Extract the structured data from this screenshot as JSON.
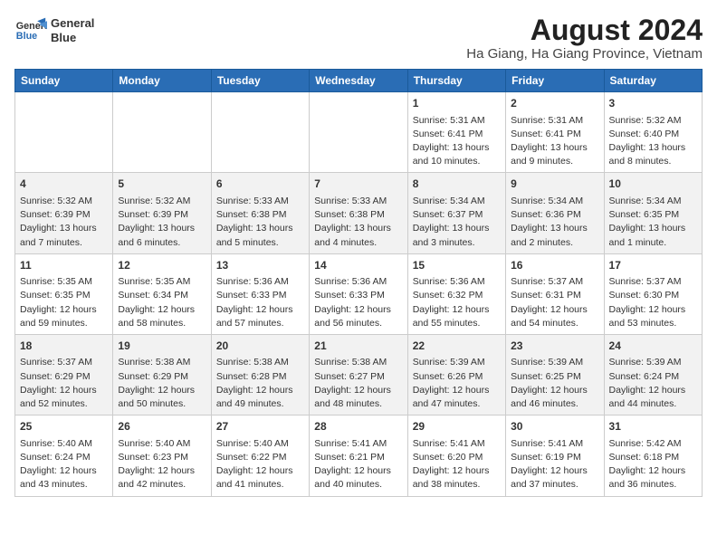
{
  "header": {
    "logo_line1": "General",
    "logo_line2": "Blue",
    "title": "August 2024",
    "subtitle": "Ha Giang, Ha Giang Province, Vietnam"
  },
  "days_of_week": [
    "Sunday",
    "Monday",
    "Tuesday",
    "Wednesday",
    "Thursday",
    "Friday",
    "Saturday"
  ],
  "weeks": [
    [
      {
        "day": "",
        "content": ""
      },
      {
        "day": "",
        "content": ""
      },
      {
        "day": "",
        "content": ""
      },
      {
        "day": "",
        "content": ""
      },
      {
        "day": "1",
        "content": "Sunrise: 5:31 AM\nSunset: 6:41 PM\nDaylight: 13 hours\nand 10 minutes."
      },
      {
        "day": "2",
        "content": "Sunrise: 5:31 AM\nSunset: 6:41 PM\nDaylight: 13 hours\nand 9 minutes."
      },
      {
        "day": "3",
        "content": "Sunrise: 5:32 AM\nSunset: 6:40 PM\nDaylight: 13 hours\nand 8 minutes."
      }
    ],
    [
      {
        "day": "4",
        "content": "Sunrise: 5:32 AM\nSunset: 6:39 PM\nDaylight: 13 hours\nand 7 minutes."
      },
      {
        "day": "5",
        "content": "Sunrise: 5:32 AM\nSunset: 6:39 PM\nDaylight: 13 hours\nand 6 minutes."
      },
      {
        "day": "6",
        "content": "Sunrise: 5:33 AM\nSunset: 6:38 PM\nDaylight: 13 hours\nand 5 minutes."
      },
      {
        "day": "7",
        "content": "Sunrise: 5:33 AM\nSunset: 6:38 PM\nDaylight: 13 hours\nand 4 minutes."
      },
      {
        "day": "8",
        "content": "Sunrise: 5:34 AM\nSunset: 6:37 PM\nDaylight: 13 hours\nand 3 minutes."
      },
      {
        "day": "9",
        "content": "Sunrise: 5:34 AM\nSunset: 6:36 PM\nDaylight: 13 hours\nand 2 minutes."
      },
      {
        "day": "10",
        "content": "Sunrise: 5:34 AM\nSunset: 6:35 PM\nDaylight: 13 hours\nand 1 minute."
      }
    ],
    [
      {
        "day": "11",
        "content": "Sunrise: 5:35 AM\nSunset: 6:35 PM\nDaylight: 12 hours\nand 59 minutes."
      },
      {
        "day": "12",
        "content": "Sunrise: 5:35 AM\nSunset: 6:34 PM\nDaylight: 12 hours\nand 58 minutes."
      },
      {
        "day": "13",
        "content": "Sunrise: 5:36 AM\nSunset: 6:33 PM\nDaylight: 12 hours\nand 57 minutes."
      },
      {
        "day": "14",
        "content": "Sunrise: 5:36 AM\nSunset: 6:33 PM\nDaylight: 12 hours\nand 56 minutes."
      },
      {
        "day": "15",
        "content": "Sunrise: 5:36 AM\nSunset: 6:32 PM\nDaylight: 12 hours\nand 55 minutes."
      },
      {
        "day": "16",
        "content": "Sunrise: 5:37 AM\nSunset: 6:31 PM\nDaylight: 12 hours\nand 54 minutes."
      },
      {
        "day": "17",
        "content": "Sunrise: 5:37 AM\nSunset: 6:30 PM\nDaylight: 12 hours\nand 53 minutes."
      }
    ],
    [
      {
        "day": "18",
        "content": "Sunrise: 5:37 AM\nSunset: 6:29 PM\nDaylight: 12 hours\nand 52 minutes."
      },
      {
        "day": "19",
        "content": "Sunrise: 5:38 AM\nSunset: 6:29 PM\nDaylight: 12 hours\nand 50 minutes."
      },
      {
        "day": "20",
        "content": "Sunrise: 5:38 AM\nSunset: 6:28 PM\nDaylight: 12 hours\nand 49 minutes."
      },
      {
        "day": "21",
        "content": "Sunrise: 5:38 AM\nSunset: 6:27 PM\nDaylight: 12 hours\nand 48 minutes."
      },
      {
        "day": "22",
        "content": "Sunrise: 5:39 AM\nSunset: 6:26 PM\nDaylight: 12 hours\nand 47 minutes."
      },
      {
        "day": "23",
        "content": "Sunrise: 5:39 AM\nSunset: 6:25 PM\nDaylight: 12 hours\nand 46 minutes."
      },
      {
        "day": "24",
        "content": "Sunrise: 5:39 AM\nSunset: 6:24 PM\nDaylight: 12 hours\nand 44 minutes."
      }
    ],
    [
      {
        "day": "25",
        "content": "Sunrise: 5:40 AM\nSunset: 6:24 PM\nDaylight: 12 hours\nand 43 minutes."
      },
      {
        "day": "26",
        "content": "Sunrise: 5:40 AM\nSunset: 6:23 PM\nDaylight: 12 hours\nand 42 minutes."
      },
      {
        "day": "27",
        "content": "Sunrise: 5:40 AM\nSunset: 6:22 PM\nDaylight: 12 hours\nand 41 minutes."
      },
      {
        "day": "28",
        "content": "Sunrise: 5:41 AM\nSunset: 6:21 PM\nDaylight: 12 hours\nand 40 minutes."
      },
      {
        "day": "29",
        "content": "Sunrise: 5:41 AM\nSunset: 6:20 PM\nDaylight: 12 hours\nand 38 minutes."
      },
      {
        "day": "30",
        "content": "Sunrise: 5:41 AM\nSunset: 6:19 PM\nDaylight: 12 hours\nand 37 minutes."
      },
      {
        "day": "31",
        "content": "Sunrise: 5:42 AM\nSunset: 6:18 PM\nDaylight: 12 hours\nand 36 minutes."
      }
    ]
  ]
}
